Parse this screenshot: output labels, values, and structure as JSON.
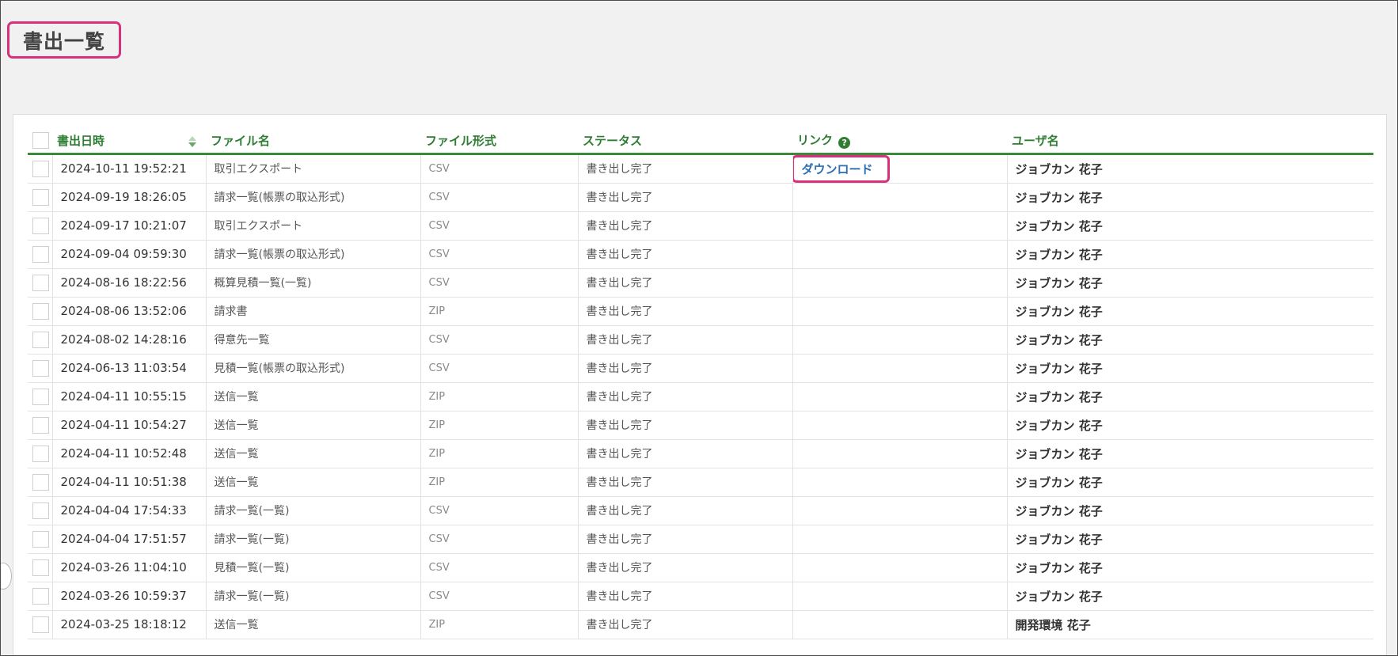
{
  "page": {
    "title": "書出一覧"
  },
  "table": {
    "headers": {
      "date": "書出日時",
      "file_name": "ファイル名",
      "file_type": "ファイル形式",
      "status": "ステータス",
      "link": "リンク",
      "user": "ユーザ名"
    },
    "sort": {
      "column": "date",
      "direction": "desc"
    },
    "help_icon_glyph": "?",
    "rows": [
      {
        "date": "2024-10-11 19:52:21",
        "file_name": "取引エクスポート",
        "file_type": "CSV",
        "status": "書き出し完了",
        "link": "ダウンロード",
        "user": "ジョブカン 花子"
      },
      {
        "date": "2024-09-19 18:26:05",
        "file_name": "請求一覧(帳票の取込形式)",
        "file_type": "CSV",
        "status": "書き出し完了",
        "link": "",
        "user": "ジョブカン 花子"
      },
      {
        "date": "2024-09-17 10:21:07",
        "file_name": "取引エクスポート",
        "file_type": "CSV",
        "status": "書き出し完了",
        "link": "",
        "user": "ジョブカン 花子"
      },
      {
        "date": "2024-09-04 09:59:30",
        "file_name": "請求一覧(帳票の取込形式)",
        "file_type": "CSV",
        "status": "書き出し完了",
        "link": "",
        "user": "ジョブカン 花子"
      },
      {
        "date": "2024-08-16 18:22:56",
        "file_name": "概算見積一覧(一覧)",
        "file_type": "CSV",
        "status": "書き出し完了",
        "link": "",
        "user": "ジョブカン 花子"
      },
      {
        "date": "2024-08-06 13:52:06",
        "file_name": "請求書",
        "file_type": "ZIP",
        "status": "書き出し完了",
        "link": "",
        "user": "ジョブカン 花子"
      },
      {
        "date": "2024-08-02 14:28:16",
        "file_name": "得意先一覧",
        "file_type": "CSV",
        "status": "書き出し完了",
        "link": "",
        "user": "ジョブカン 花子"
      },
      {
        "date": "2024-06-13 11:03:54",
        "file_name": "見積一覧(帳票の取込形式)",
        "file_type": "CSV",
        "status": "書き出し完了",
        "link": "",
        "user": "ジョブカン 花子"
      },
      {
        "date": "2024-04-11 10:55:15",
        "file_name": "送信一覧",
        "file_type": "ZIP",
        "status": "書き出し完了",
        "link": "",
        "user": "ジョブカン 花子"
      },
      {
        "date": "2024-04-11 10:54:27",
        "file_name": "送信一覧",
        "file_type": "ZIP",
        "status": "書き出し完了",
        "link": "",
        "user": "ジョブカン 花子"
      },
      {
        "date": "2024-04-11 10:52:48",
        "file_name": "送信一覧",
        "file_type": "ZIP",
        "status": "書き出し完了",
        "link": "",
        "user": "ジョブカン 花子"
      },
      {
        "date": "2024-04-11 10:51:38",
        "file_name": "送信一覧",
        "file_type": "ZIP",
        "status": "書き出し完了",
        "link": "",
        "user": "ジョブカン 花子"
      },
      {
        "date": "2024-04-04 17:54:33",
        "file_name": "請求一覧(一覧)",
        "file_type": "CSV",
        "status": "書き出し完了",
        "link": "",
        "user": "ジョブカン 花子"
      },
      {
        "date": "2024-04-04 17:51:57",
        "file_name": "請求一覧(一覧)",
        "file_type": "CSV",
        "status": "書き出し完了",
        "link": "",
        "user": "ジョブカン 花子"
      },
      {
        "date": "2024-03-26 11:04:10",
        "file_name": "見積一覧(一覧)",
        "file_type": "CSV",
        "status": "書き出し完了",
        "link": "",
        "user": "ジョブカン 花子"
      },
      {
        "date": "2024-03-26 10:59:37",
        "file_name": "請求一覧(一覧)",
        "file_type": "CSV",
        "status": "書き出し完了",
        "link": "",
        "user": "ジョブカン 花子"
      },
      {
        "date": "2024-03-25 18:18:12",
        "file_name": "送信一覧",
        "file_type": "ZIP",
        "status": "書き出し完了",
        "link": "",
        "user": "開発環境 花子"
      }
    ]
  },
  "colors": {
    "header_text": "#2e7d32",
    "header_rule": "#3a8a3a",
    "highlight": "#d6317a",
    "link": "#2a6db5"
  },
  "icons": {
    "sort": "sort-desc-icon",
    "help": "question-circle-icon"
  }
}
